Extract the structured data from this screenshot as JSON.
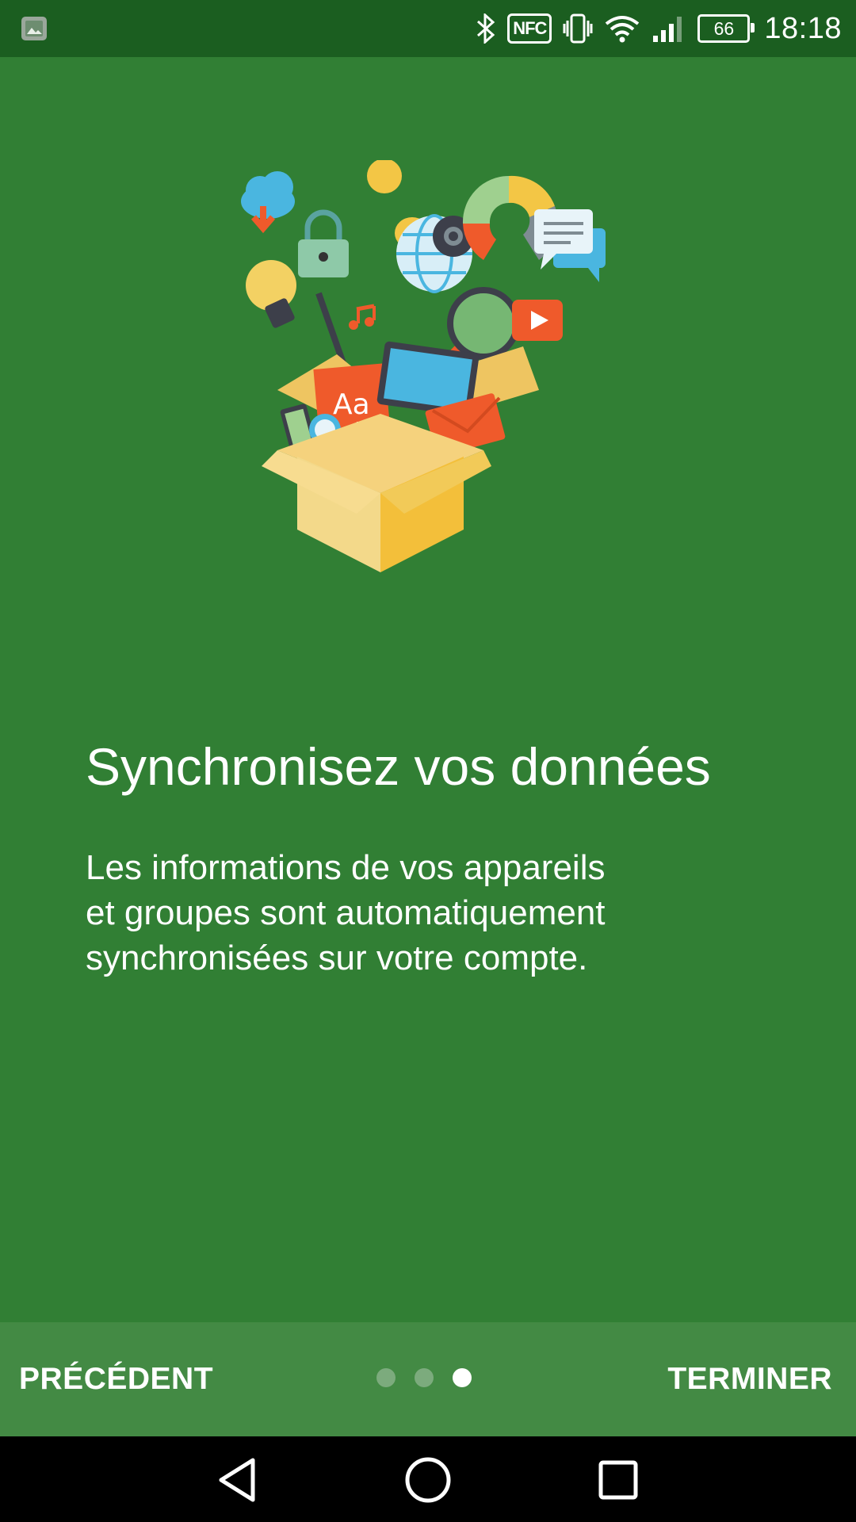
{
  "status_bar": {
    "time": "18:18",
    "battery_level": "66",
    "nfc_label": "NFC",
    "icons": [
      "image-notification-icon",
      "bluetooth-icon",
      "nfc-icon",
      "vibrate-icon",
      "wifi-icon",
      "signal-icon",
      "battery-icon"
    ]
  },
  "onboarding": {
    "title": "Synchronisez vos données",
    "body_line_1": "Les informations de vos appareils",
    "body_line_2": "et groupes sont automatiquement",
    "body_line_3": "synchronisées sur votre compte.",
    "illustration": "open-box-with-apps-illustration",
    "page_index": 3,
    "page_count": 3
  },
  "bottom_bar": {
    "previous_label": "PRÉCÉDENT",
    "finish_label": "TERMINER"
  },
  "navigation_bar": {
    "icons": [
      "back-icon",
      "home-icon",
      "recent-apps-icon"
    ]
  },
  "colors": {
    "status_bar": "#1b5e20",
    "background": "#317f34",
    "bottom_bar": "#438a44",
    "active_dot": "#ffffff",
    "inactive_dot": "#7cab7d"
  }
}
